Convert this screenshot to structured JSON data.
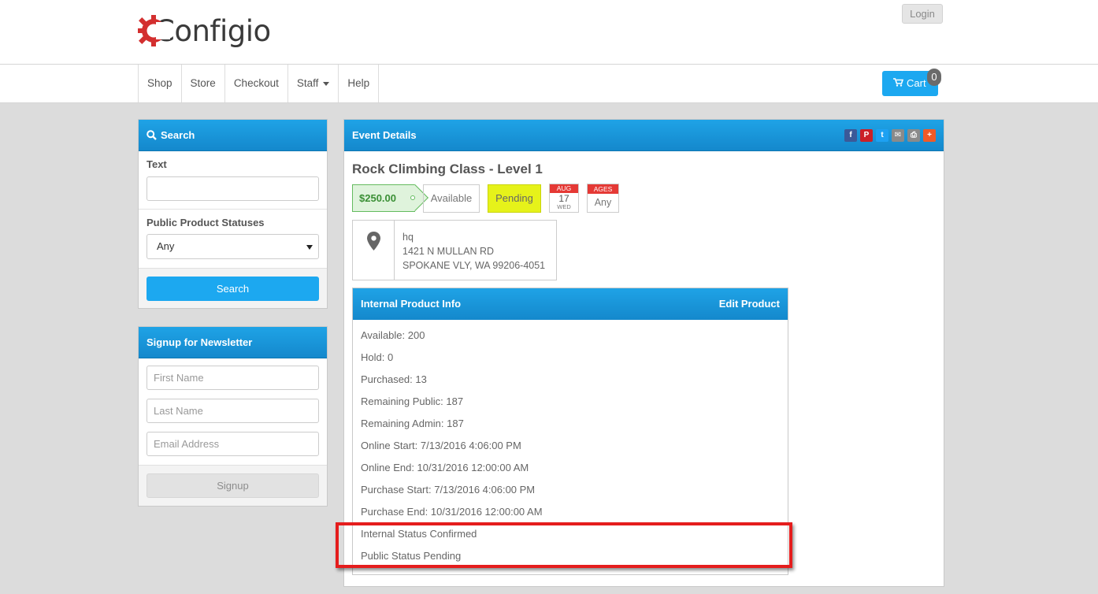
{
  "header": {
    "logo_text": "Configio",
    "login_label": "Login"
  },
  "nav": {
    "items": [
      "Shop",
      "Store",
      "Checkout",
      "Staff",
      "Help"
    ],
    "cart_label": "Cart",
    "cart_count": "0"
  },
  "search_panel": {
    "title": "Search",
    "text_label": "Text",
    "text_value": "",
    "status_label": "Public Product Statuses",
    "status_selected": "Any",
    "search_button": "Search"
  },
  "newsletter": {
    "title": "Signup for Newsletter",
    "first_name_placeholder": "First Name",
    "last_name_placeholder": "Last Name",
    "email_placeholder": "Email Address",
    "signup_button": "Signup"
  },
  "event": {
    "panel_title": "Event Details",
    "title": "Rock Climbing Class - Level 1",
    "price": "$250.00",
    "availability": "Available",
    "status": "Pending",
    "date": {
      "month": "AUG",
      "day": "17",
      "weekday": "WED"
    },
    "ages": {
      "label": "AGES",
      "value": "Any"
    },
    "location": {
      "name": "hq",
      "address1": "1421 N MULLAN RD",
      "address2": "SPOKANE VLY, WA 99206-4051"
    },
    "social_icons": [
      "facebook-icon",
      "pinterest-icon",
      "twitter-icon",
      "email-icon",
      "print-icon",
      "plus-icon"
    ]
  },
  "internal_info": {
    "title": "Internal Product Info",
    "edit_label": "Edit Product",
    "rows": [
      "Available: 200",
      "Hold: 0",
      "Purchased: 13",
      "Remaining Public: 187",
      "Remaining Admin: 187",
      "Online Start: 7/13/2016 4:06:00 PM",
      "Online End: 10/31/2016 12:00:00 AM",
      "Purchase Start: 7/13/2016 4:06:00 PM",
      "Purchase End: 10/31/2016 12:00:00 AM",
      "Internal Status Confirmed",
      "Public Status Pending"
    ]
  },
  "colors": {
    "accent": "#1ca8f0",
    "logo_gear": "#d32f2f",
    "pending_bg": "#e6f21a",
    "price_green": "#3a8f35",
    "highlight_red": "#e51d1d"
  }
}
